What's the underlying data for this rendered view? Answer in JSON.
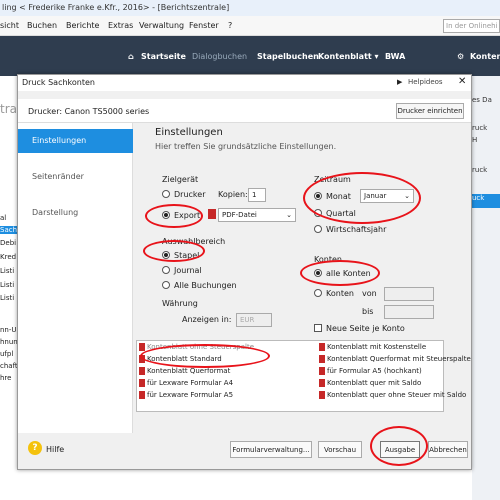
{
  "window": {
    "title": "ling < Frederike Franke e.Kfr., 2016> - [Berichtszentrale]",
    "help_search_placeholder": "In der Onlinehi"
  },
  "menu": [
    "sicht",
    "Buchen",
    "Berichte",
    "Extras",
    "Verwaltung",
    "Fenster",
    "?"
  ],
  "toolbar": {
    "home": "Startseite",
    "dialog": "Dialogbuchen",
    "stapel": "Stapelbuchen",
    "konten": "Kontenblatt ▾",
    "bwa": "BWA",
    "right": "Konten"
  },
  "left_strip": [
    "tra",
    "al",
    "Sach",
    "Debi",
    "Kred",
    "Listi",
    "Listi",
    "Listi",
    "nn-U",
    "hnun",
    "ufpl",
    "chaft",
    "hre"
  ],
  "right_strip": [
    "es Da",
    "ruck",
    "H",
    "ruck",
    "uck"
  ],
  "dialog": {
    "title": "Druck Sachkonten",
    "help": "Helpideos",
    "close": "✕",
    "printer": "Drucker:  Canon TS5000 series",
    "printer_setup": "Drucker einrichten",
    "nav": [
      "Einstellungen",
      "Seitenränder",
      "Darstellung"
    ],
    "heading": "Einstellungen",
    "subheading": "Hier treffen Sie grundsätzliche Einstellungen.",
    "ziel": {
      "label": "Zielgerät",
      "drucker": "Drucker",
      "kopien_label": "Kopien:",
      "kopien": "1",
      "export": "Export",
      "format": "PDF-Datei"
    },
    "auswahl": {
      "label": "Auswahlbereich",
      "stapel": "Stapel",
      "journal": "Journal",
      "alle": "Alle Buchungen"
    },
    "waehrung": {
      "label": "Währung",
      "anzeigen": "Anzeigen in:",
      "value": "EUR"
    },
    "zeitraum": {
      "label": "Zeitraum",
      "monat": "Monat",
      "monat_value": "Januar",
      "quartal": "Quartal",
      "wj": "Wirtschaftsjahr"
    },
    "konten": {
      "label": "Konten",
      "alle": "alle Konten",
      "konten": "Konten",
      "von": "von",
      "bis": "bis",
      "neue_seite": "Neue Seite je Konto"
    },
    "list_left": [
      "Kontenblatt ohne Steuerspalte",
      "Kontenblatt Standard",
      "Kontenblatt Querformat",
      "für Lexware Formular A4",
      "für Lexware Formular A5"
    ],
    "list_right": [
      "Kontenblatt mit Kostenstelle",
      "Kontenblatt Querformat mit Steuerspalte",
      "für Formular A5 (hochkant)",
      "Kontenblatt quer mit Saldo",
      "Kontenblatt quer ohne Steuer mit Saldo"
    ],
    "footer": {
      "hilfe": "Hilfe",
      "formular": "Formularverwaltung...",
      "vorschau": "Vorschau",
      "ausgabe": "Ausgabe",
      "abbrechen": "Abbrechen"
    }
  },
  "colors": {
    "accent": "#1e8ee0",
    "highlight_circle": "#e8131a",
    "toolbar": "#2f3d4f"
  }
}
